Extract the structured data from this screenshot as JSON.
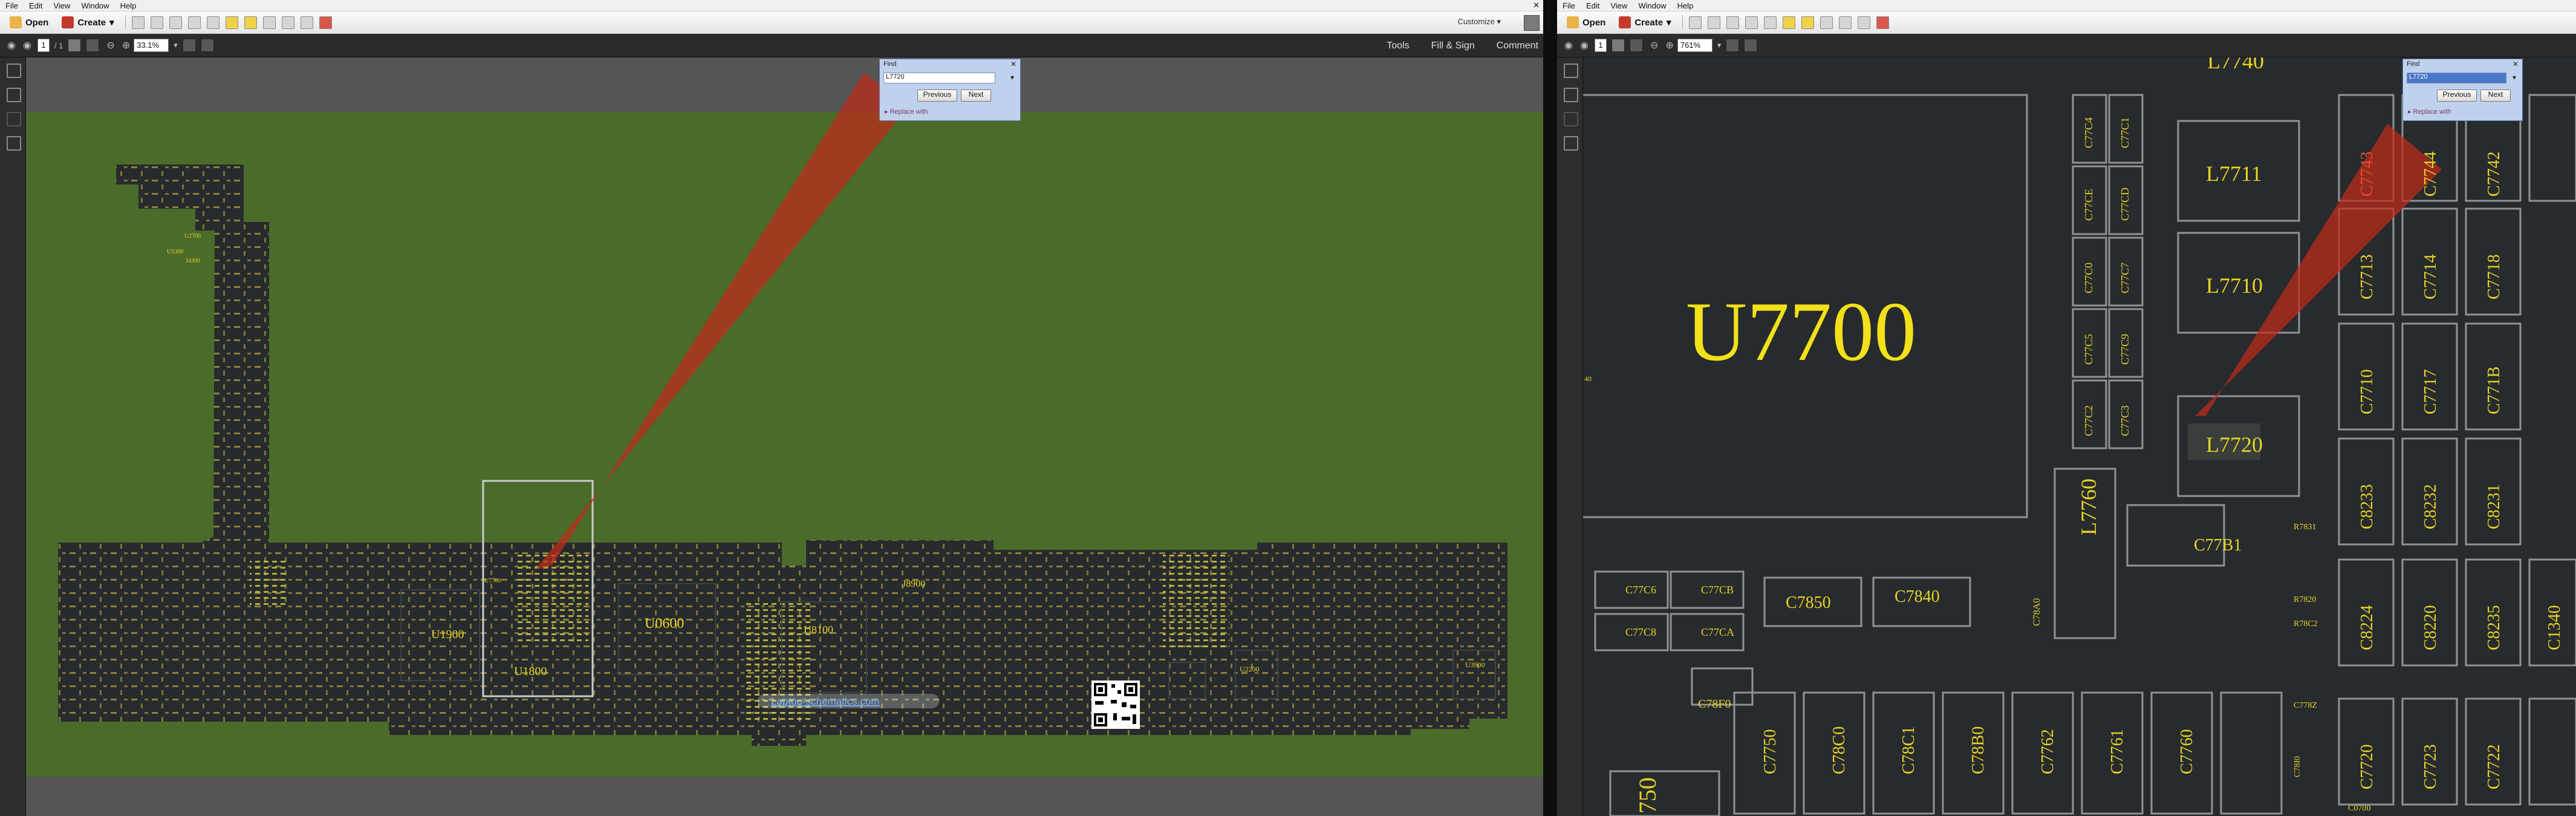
{
  "menu": [
    "File",
    "Edit",
    "View",
    "Window",
    "Help"
  ],
  "toolbar": {
    "open_label": "Open",
    "create_label": "Create",
    "customize_label": "Customize"
  },
  "navbar": {
    "page_current": "1",
    "page_total": "/ 1",
    "left_zoom": "33.1%",
    "right_zoom": "761%",
    "links": [
      "Tools",
      "Fill & Sign",
      "Comment"
    ]
  },
  "find": {
    "title": "Find",
    "query": "L7720",
    "previous_label": "Previous",
    "next_label": "Next",
    "option_label": "Replace with"
  },
  "overview": {
    "components": [
      "U1900",
      "U1800",
      "U0600",
      "U8100",
      "J8900",
      "U2200",
      "U3900",
      "J4300",
      "U2700",
      "U5300",
      "U7700"
    ],
    "watermark_link": "Laptop-schematics.com"
  },
  "zoom_view": {
    "big_label": "U7700",
    "edge_label": "40",
    "labels": [
      "L7740",
      "L7711",
      "L7710",
      "L7720",
      "L7760",
      "C77B1",
      "C7850",
      "C7840",
      "C78F0",
      "C7750",
      "C78C0",
      "C78C1",
      "C78B0",
      "C7762",
      "C7761",
      "C7760",
      "C7743",
      "C7744",
      "C7742",
      "C7713",
      "C7714",
      "C7718",
      "C7710",
      "C7717",
      "C771B",
      "C8233",
      "C8232",
      "C8231",
      "C8224",
      "C8220",
      "C8235",
      "C1340",
      "C7720",
      "C7723",
      "C7722",
      "C77C6",
      "C77C8",
      "C77CB",
      "C77CA",
      "C77C4",
      "C77C1",
      "C77CE",
      "C77CD",
      "C77C0",
      "C77C7",
      "C77C5",
      "C77C9",
      "C77C2",
      "C77C3",
      "C78A0",
      "R7831",
      "R7820",
      "R78C2",
      "C778Z",
      "C78I0",
      "C0700"
    ],
    "bottom_partial": "750"
  },
  "colors": {
    "board_green": "#4a6b2a",
    "pcb_dark": "#272b2d",
    "silkscreen_yellow": "#e6d327",
    "highlight_red": "#c0291a"
  }
}
